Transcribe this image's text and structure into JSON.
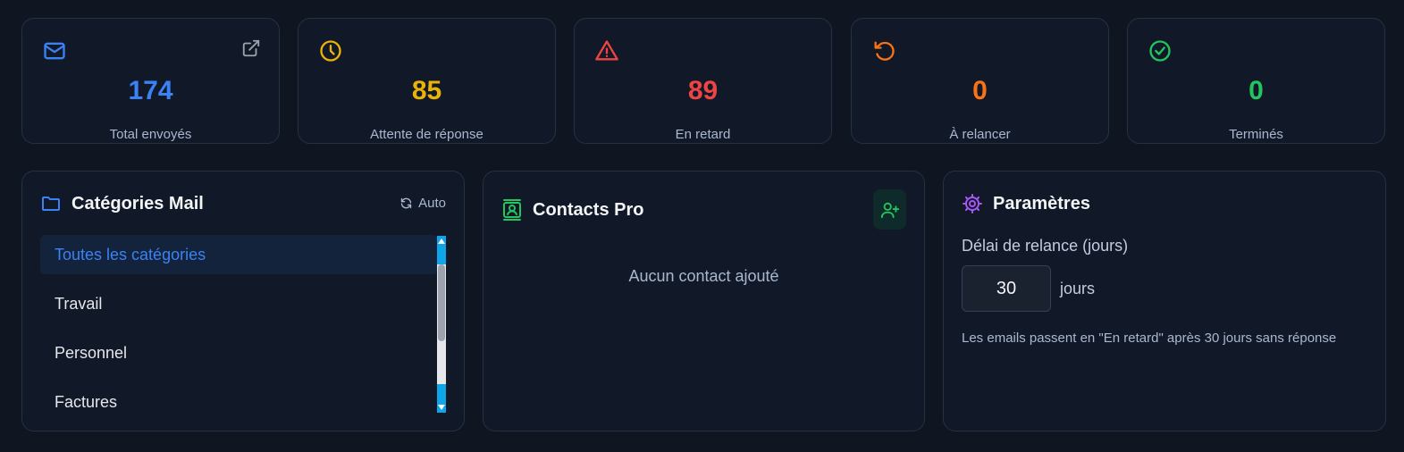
{
  "stats": [
    {
      "value": "174",
      "label": "Total envoyés",
      "icon": "mail-icon",
      "color": "#3b82f6"
    },
    {
      "value": "85",
      "label": "Attente de réponse",
      "icon": "clock-icon",
      "color": "#eab308"
    },
    {
      "value": "89",
      "label": "En retard",
      "icon": "alert-triangle-icon",
      "color": "#ef4444"
    },
    {
      "value": "0",
      "label": "À relancer",
      "icon": "rotate-ccw-icon",
      "color": "#f97316"
    },
    {
      "value": "0",
      "label": "Terminés",
      "icon": "check-circle-icon",
      "color": "#22c55e"
    }
  ],
  "categories": {
    "title": "Catégories Mail",
    "auto_label": "Auto",
    "items": [
      "Toutes les catégories",
      "Travail",
      "Personnel",
      "Factures"
    ],
    "selected": "Toutes les catégories"
  },
  "contacts": {
    "title": "Contacts Pro",
    "empty_text": "Aucun contact ajouté"
  },
  "settings": {
    "title": "Paramètres",
    "delay_label": "Délai de relance (jours)",
    "delay_value": "30",
    "unit": "jours",
    "help_text": "Les emails passent en \"En retard\" après 30 jours sans réponse"
  }
}
